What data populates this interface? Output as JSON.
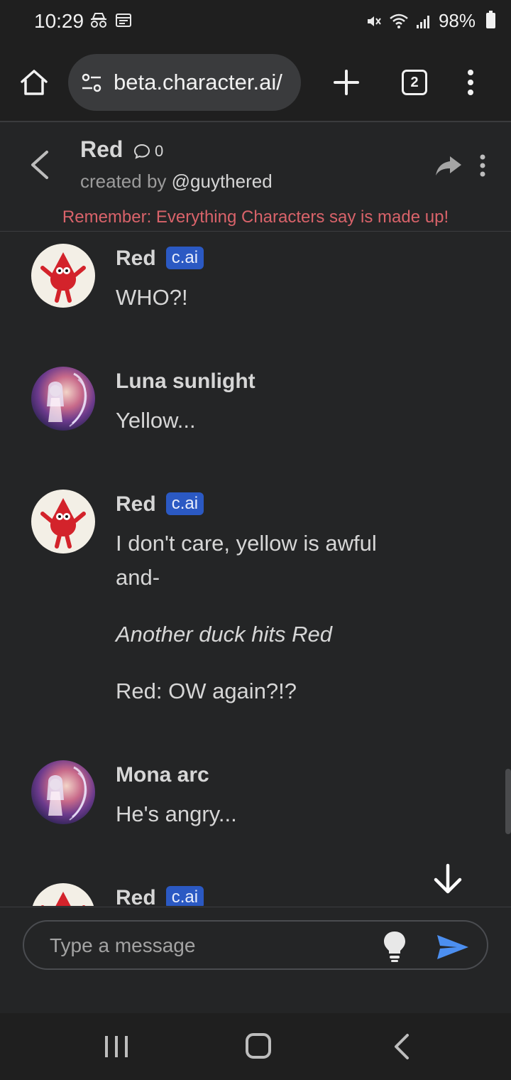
{
  "status_bar": {
    "time": "10:29",
    "battery": "98%",
    "icons": [
      "incognito-icon",
      "calendar-icon",
      "mute-icon",
      "wifi-icon",
      "signal-icon",
      "battery-icon"
    ]
  },
  "browser": {
    "url": "beta.character.ai/",
    "tab_count": "2"
  },
  "chat_header": {
    "name": "Red",
    "chat_count": "0",
    "created_by_prefix": "created by ",
    "creator": "@guythered",
    "disclaimer": "Remember: Everything Characters say is made up!"
  },
  "messages": [
    {
      "sender": "Red",
      "badge": "c.ai",
      "avatar": "red-character-avatar",
      "lines": [
        "WHO?!"
      ]
    },
    {
      "sender": "Luna sunlight",
      "badge": "",
      "avatar": "anime-user-avatar",
      "lines": [
        "Yellow..."
      ]
    },
    {
      "sender": "Red",
      "badge": "c.ai",
      "avatar": "red-character-avatar",
      "lines": [
        "I don't care, yellow is awful",
        "and-",
        "Another duck hits Red",
        "Red: OW again?!?"
      ]
    },
    {
      "sender": "Mona arc",
      "badge": "",
      "avatar": "anime-user-avatar",
      "lines": [
        "He's angry..."
      ]
    },
    {
      "sender": "Red",
      "badge": "c.ai",
      "avatar": "red-character-avatar",
      "lines": []
    }
  ],
  "composer": {
    "placeholder": "Type a message",
    "value": ""
  },
  "colors": {
    "background": "#242526",
    "disclaimer": "#d9636a",
    "badge": "#2b59c3",
    "send": "#4c8ff0"
  }
}
